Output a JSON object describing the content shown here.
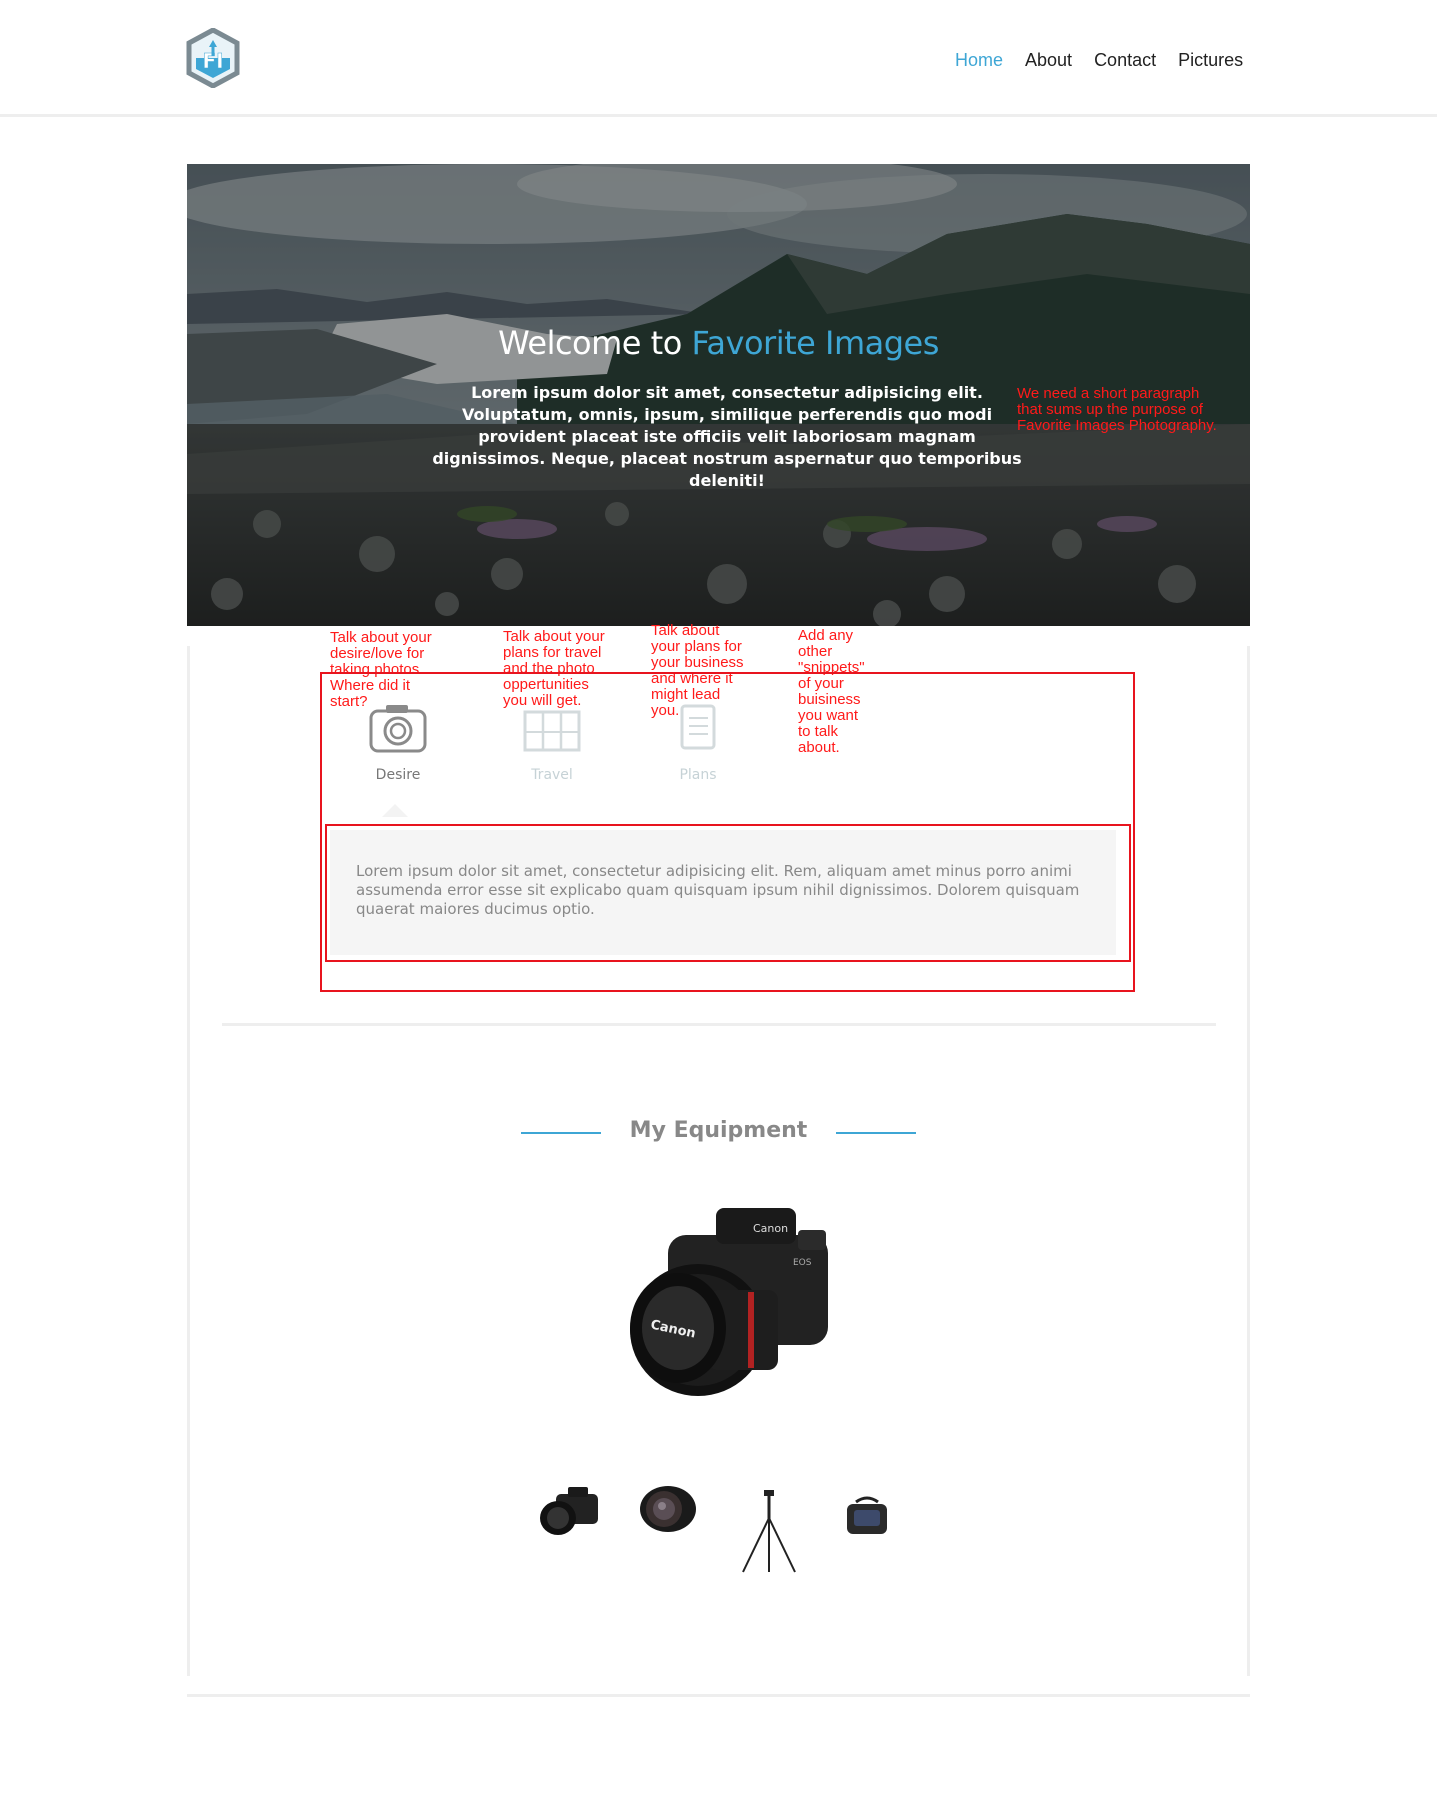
{
  "nav": {
    "home": "Home",
    "about": "About",
    "contact": "Contact",
    "pictures": "Pictures"
  },
  "logo": {
    "text": "FI"
  },
  "hero": {
    "title_part1": "Welcome to ",
    "title_part2": "Favorite Images",
    "text": "Lorem ipsum dolor sit amet, consectetur adipisicing elit. Voluptatum, omnis, ipsum, similique perferendis quo modi provident placeat iste officiis velit laboriosam magnam dignissimos. Neque, placeat nostrum aspernatur quo temporibus deleniti!",
    "note": "We need a short paragraph that sums up the purpose of Favorite Images Photography."
  },
  "notes": {
    "desire": "Talk about your desire/love for taking photos. Where did it start?",
    "travel": "Talk about your plans for travel and the photo oppertunities you will get.",
    "plans": "Talk about your plans for your business and where it might lead you.",
    "snippets": "Add any other \"snippets\" of your buisiness you want to talk about."
  },
  "tabs": [
    {
      "label": "Desire",
      "icon": "camera-icon",
      "active": true
    },
    {
      "label": "Travel",
      "icon": "map-icon",
      "active": false
    },
    {
      "label": "Plans",
      "icon": "notebook-icon",
      "active": false
    }
  ],
  "tab_content": "Lorem ipsum dolor sit amet, consectetur adipisicing elit. Rem, aliquam amet minus porro animi assumenda error esse sit explicabo quam quisquam ipsum nihil dignissimos. Dolorem quisquam quaerat maiores ducimus optio.",
  "equipment": {
    "title": "My Equipment",
    "thumbs": [
      "camera-body",
      "lens",
      "tripod",
      "camera-bag"
    ]
  },
  "colors": {
    "accent": "#3ea6d5",
    "note_red": "#ff1a1a",
    "box_red": "#e8141e"
  }
}
